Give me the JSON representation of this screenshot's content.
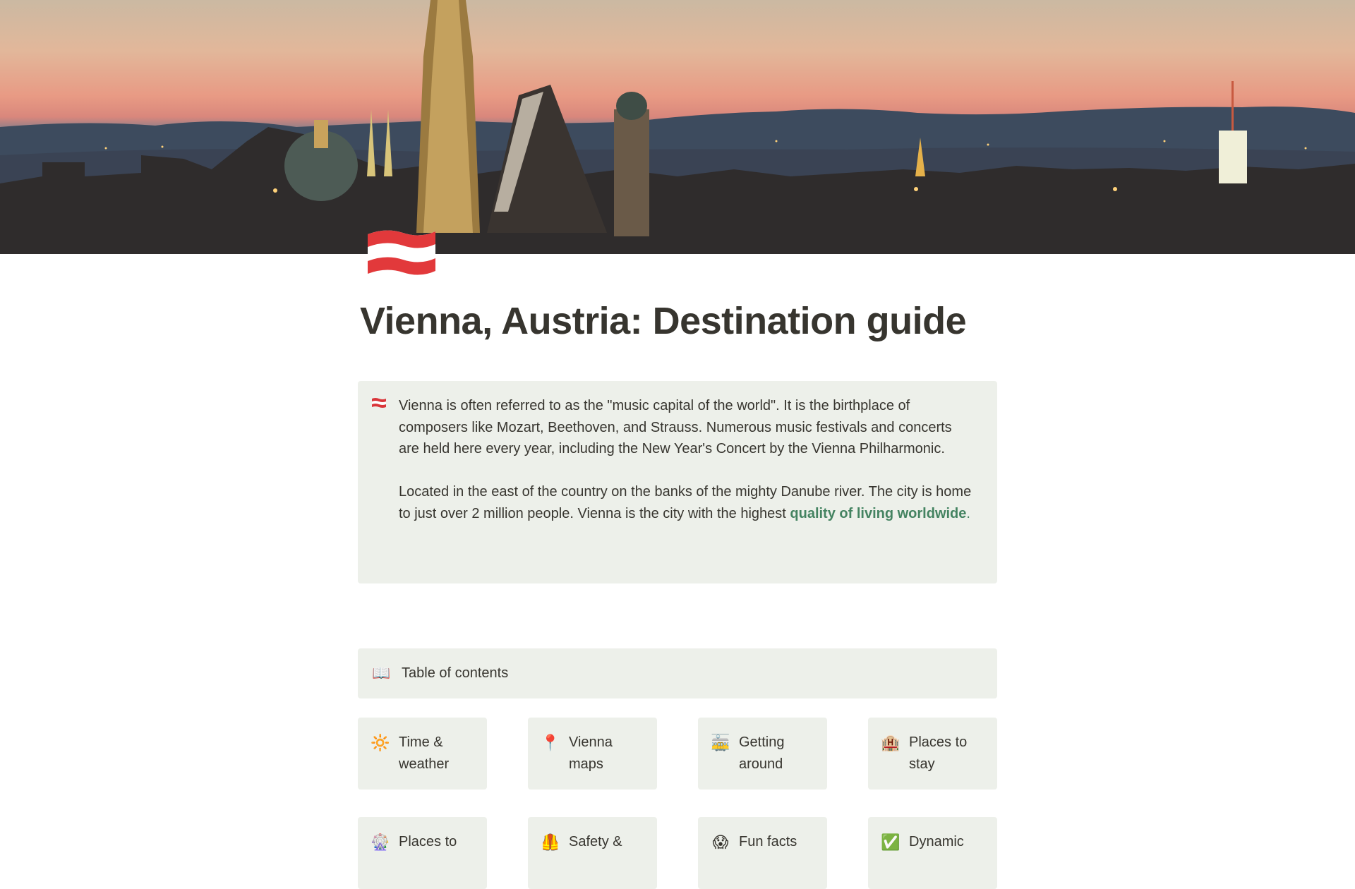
{
  "cover": {
    "description": "Vienna skyline at sunset with St. Stephen's Cathedral"
  },
  "page": {
    "icon": "🇦🇹",
    "title": "Vienna, Austria: Destination guide"
  },
  "intro_callout": {
    "icon": "austria-flag",
    "paragraph1": "Vienna is often referred to as the \"music capital of the world\". It is the birthplace of composers like Mozart, Beethoven, and Strauss. Numerous music festivals and concerts are held here every year, including the New Year's Concert by the Vienna Philharmonic.",
    "paragraph2_prefix": "Located in the east of the country on the banks of the mighty Danube river. The city is home to just over 2 million people. Vienna is the city with the highest ",
    "paragraph2_link": "quality of living worldwide",
    "paragraph2_suffix": ".",
    "link_color": "#448361",
    "background_color": "#edf0ea"
  },
  "toc": {
    "icon": "📖",
    "label": "Table of contents"
  },
  "cards": [
    {
      "icon": "🔆",
      "label": "Time & weather"
    },
    {
      "icon": "📍",
      "label": "Vienna maps"
    },
    {
      "icon": "🚋",
      "label": "Getting around"
    },
    {
      "icon": "🏨",
      "label": "Places to stay"
    },
    {
      "icon": "🎡",
      "label": "Places to"
    },
    {
      "icon": "🦺",
      "label": "Safety &"
    },
    {
      "icon": "😱",
      "label": "Fun facts"
    },
    {
      "icon": "✅",
      "label": "Dynamic"
    }
  ]
}
